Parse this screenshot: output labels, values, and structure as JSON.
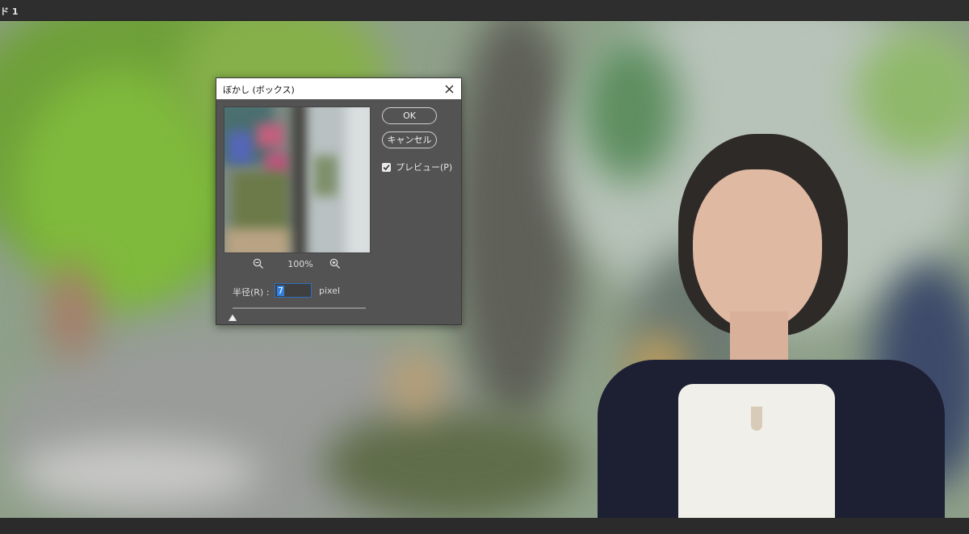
{
  "document": {
    "tab_title": "ド 1"
  },
  "dialog": {
    "title": "ぼかし (ボックス)",
    "ok_label": "OK",
    "cancel_label": "キャンセル",
    "preview_label": "プレビュー(P)",
    "preview_checked": true,
    "zoom_level": "100%",
    "radius_label": "半径(R) :",
    "radius_value": "7",
    "radius_unit": "pixel"
  },
  "icons": {
    "close": "close-icon",
    "zoom_out": "zoom-out-icon",
    "zoom_in": "zoom-in-icon",
    "check": "checkmark-icon"
  },
  "colors": {
    "dialog_bg": "#535353",
    "selection": "#2f7fe0",
    "app_bar": "#2e2e2e"
  }
}
